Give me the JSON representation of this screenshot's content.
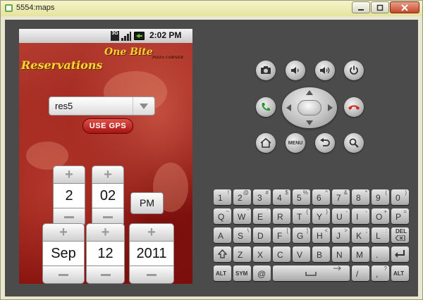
{
  "window": {
    "title": "5554:maps"
  },
  "statusbar": {
    "network": "3G",
    "time": "2:02 PM"
  },
  "app": {
    "logo_text": "One Bite",
    "logo_sub": "PIZZA CORNER",
    "heading": "Reservations",
    "spinner_value": "res5",
    "gps_label": "USE GPS",
    "time_picker": {
      "hour": "2",
      "minute": "02",
      "ampm": "PM"
    },
    "date_picker": {
      "month": "Sep",
      "day": "12",
      "year": "2011"
    }
  },
  "controls": {
    "menu_label": "MENU"
  },
  "keyboard": {
    "row1": [
      [
        "1",
        "!"
      ],
      [
        "2",
        "@"
      ],
      [
        "3",
        "#"
      ],
      [
        "4",
        "$"
      ],
      [
        "5",
        "%"
      ],
      [
        "6",
        "^"
      ],
      [
        "7",
        "&"
      ],
      [
        "8",
        "*"
      ],
      [
        "9",
        "("
      ],
      [
        "0",
        ")"
      ]
    ],
    "row2": [
      [
        "Q",
        "~"
      ],
      [
        "W",
        "\""
      ],
      [
        "E",
        "´"
      ],
      [
        "R",
        ""
      ],
      [
        "T",
        "{"
      ],
      [
        "Y",
        "}"
      ],
      [
        "U",
        "-"
      ],
      [
        "I",
        "-"
      ],
      [
        "O",
        "+"
      ],
      [
        "P",
        "="
      ]
    ],
    "row3": [
      [
        "A",
        ""
      ],
      [
        "S",
        "\\"
      ],
      [
        "D",
        ""
      ],
      [
        "F",
        "["
      ],
      [
        "G",
        "]"
      ],
      [
        "H",
        "<"
      ],
      [
        "J",
        ">"
      ],
      [
        "K",
        ";"
      ],
      [
        "L",
        ":"
      ],
      [
        "DEL",
        ""
      ]
    ],
    "row4": [
      [
        "Z",
        ""
      ],
      [
        "X",
        ""
      ],
      [
        "C",
        ""
      ],
      [
        "V",
        ""
      ],
      [
        "B",
        ""
      ],
      [
        "N",
        ""
      ],
      [
        "M",
        ""
      ],
      [
        ".",
        ""
      ]
    ],
    "row5": {
      "alt": "ALT",
      "sym": "SYM",
      "at": "@",
      "slash": "/",
      "question": "?",
      "comma": ","
    }
  }
}
